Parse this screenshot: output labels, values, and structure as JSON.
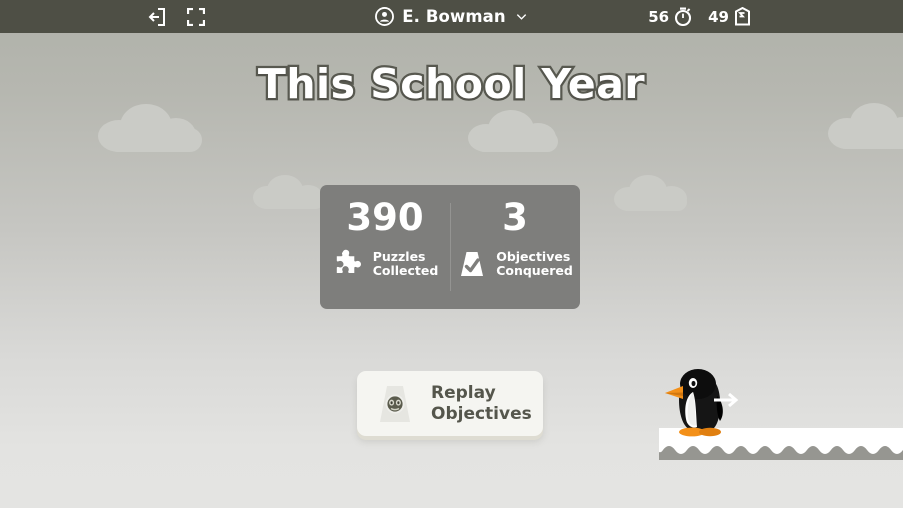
{
  "topbar": {
    "exit_icon": "exit-icon",
    "fullscreen_icon": "fullscreen-icon",
    "account_icon": "account-circle-icon",
    "account_name": "E. Bowman",
    "dropdown_icon": "chevron-down-icon",
    "timer_value": "56",
    "timer_icon": "stopwatch-icon",
    "token_value": "49",
    "token_icon": "badge-token-icon",
    "background_color": "#4e4f45"
  },
  "page": {
    "title": "This School Year",
    "background_top_color": "#afb1a9",
    "background_bottom_color": "#e4e4e2",
    "cloud_color": "#cacbc6"
  },
  "stats": {
    "card_color": "#7e7e7c",
    "items": [
      {
        "value": "390",
        "label_line1": "Puzzles",
        "label_line2": "Collected",
        "icon": "puzzle-piece-icon"
      },
      {
        "value": "3",
        "label_line1": "Objectives",
        "label_line2": "Conquered",
        "icon": "objective-check-icon"
      }
    ]
  },
  "replay_button": {
    "icon": "objective-mask-icon",
    "label_line1": "Replay",
    "label_line2": "Objectives",
    "background_color": "#f5f5f1",
    "text_color": "#55564c"
  },
  "scene": {
    "character": "penguin-avatar",
    "direction_icon": "arrow-right-icon",
    "platform": "snow-ledge"
  }
}
